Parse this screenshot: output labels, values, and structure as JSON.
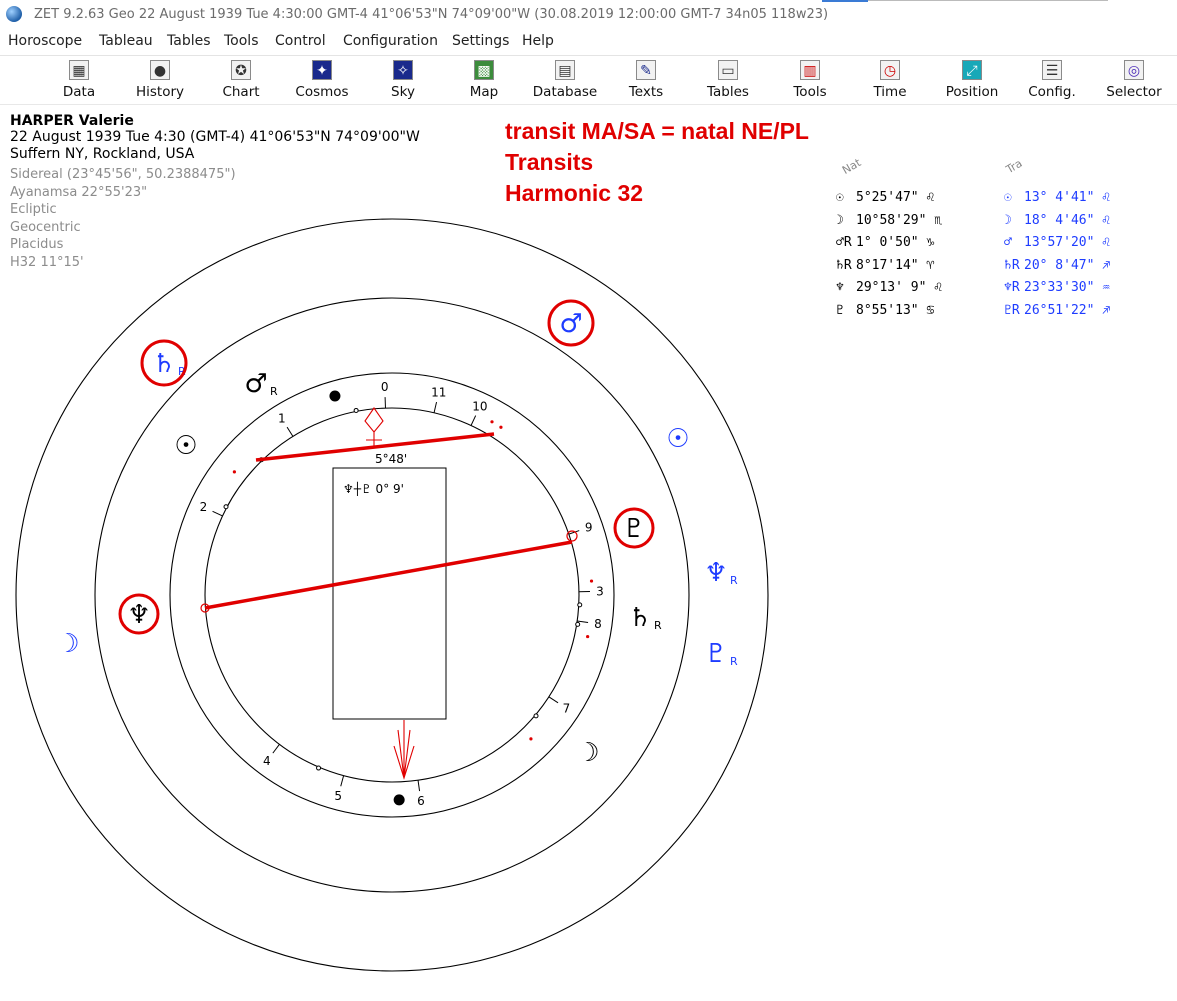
{
  "window": {
    "title": "ZET 9.2.63 Geo   22 August 1939  Tue   4:30:00 GMT-4 41°06'53\"N  74°09'00\"W  (30.08.2019  12:00:00 GMT-7 34n05 118w23)"
  },
  "menu": [
    "Horoscope",
    "Tableau",
    "Tables",
    "Tools",
    "Control",
    "Configuration",
    "Settings",
    "Help"
  ],
  "toolbar": [
    {
      "label": "Data",
      "icon": "data-icon",
      "glyph": "▦"
    },
    {
      "label": "History",
      "icon": "history-icon",
      "glyph": "●"
    },
    {
      "label": "Chart",
      "icon": "chart-icon",
      "glyph": "✪"
    },
    {
      "label": "Cosmos",
      "icon": "cosmos-icon",
      "glyph": "✦"
    },
    {
      "label": "Sky",
      "icon": "sky-icon",
      "glyph": "✧"
    },
    {
      "label": "Map",
      "icon": "map-icon",
      "glyph": "▩"
    },
    {
      "label": "Database",
      "icon": "database-icon",
      "glyph": "▤"
    },
    {
      "label": "Texts",
      "icon": "texts-icon",
      "glyph": "✎"
    },
    {
      "label": "Tables",
      "icon": "tables-icon",
      "glyph": "▭"
    },
    {
      "label": "Tools",
      "icon": "tools-icon",
      "glyph": "▥"
    },
    {
      "label": "Time",
      "icon": "time-icon",
      "glyph": "◷"
    },
    {
      "label": "Position",
      "icon": "position-icon",
      "glyph": "⤢"
    },
    {
      "label": "Config.",
      "icon": "config-icon",
      "glyph": "☰"
    },
    {
      "label": "Selector",
      "icon": "selector-icon",
      "glyph": "◎"
    }
  ],
  "person": {
    "name": "HARPER Valerie",
    "date_line": "22 August 1939  Tue   4:30 (GMT-4) 41°06'53\"N  74°09'00\"W",
    "place": "Suffern NY, Rockland, USA",
    "settings": [
      "Sidereal (23°45'56\", 50.2388475\")",
      "Ayanamsa 22°55'23\"",
      "Ecliptic",
      "Geocentric",
      "Placidus",
      "H32  11°15'"
    ]
  },
  "annotation": [
    "transit MA/SA = natal NE/PL",
    "Transits",
    "Harmonic 32"
  ],
  "table": {
    "natal_header": "Nat",
    "transit_header": "Tra",
    "natal": [
      {
        "sym": "☉",
        "pos": "5°25'47\" ♌"
      },
      {
        "sym": "☽",
        "pos": "10°58'29\" ♏"
      },
      {
        "sym": "♂R",
        "pos": "1° 0'50\" ♑"
      },
      {
        "sym": "♄R",
        "pos": "8°17'14\" ♈"
      },
      {
        "sym": "♆",
        "pos": "29°13' 9\" ♌"
      },
      {
        "sym": "♇",
        "pos": "8°55'13\" ♋"
      }
    ],
    "transit": [
      {
        "sym": "☉",
        "pos": "13° 4'41\" ♌"
      },
      {
        "sym": "☽",
        "pos": "18° 4'46\" ♌"
      },
      {
        "sym": "♂",
        "pos": "13°57'20\" ♌"
      },
      {
        "sym": "♄R",
        "pos": "20° 8'47\" ♐"
      },
      {
        "sym": "♆R",
        "pos": "23°33'30\" ♒"
      },
      {
        "sym": "♇R",
        "pos": "26°51'22\" ♐"
      }
    ]
  },
  "chart": {
    "midpoint_label": "5°48'",
    "box_label": "♆┼♇  0° 9'",
    "house_cusps": [
      "0",
      "11",
      "10",
      "9",
      "8",
      "7",
      "6",
      "5",
      "4",
      "3",
      "2",
      "1"
    ],
    "outer_planets": [
      {
        "glyph": "♄",
        "sub": "R",
        "color": "#1e3cff",
        "circled": true
      },
      {
        "glyph": "♂",
        "sub": "",
        "color": "#1e3cff",
        "circled": true
      },
      {
        "glyph": "☉",
        "sub": "",
        "color": "#1e3cff",
        "circled": false
      },
      {
        "glyph": "♆",
        "sub": "R",
        "color": "#1e3cff",
        "circled": false
      },
      {
        "glyph": "♇",
        "sub": "R",
        "color": "#1e3cff",
        "circled": false
      },
      {
        "glyph": "☽",
        "sub": "",
        "color": "#1e3cff",
        "circled": false
      }
    ],
    "inner_planets": [
      {
        "glyph": "♂",
        "sub": "R",
        "color": "#000000",
        "circled": false
      },
      {
        "glyph": "☉",
        "sub": "",
        "color": "#000000",
        "circled": false
      },
      {
        "glyph": "♇",
        "sub": "",
        "color": "#000000",
        "circled": true
      },
      {
        "glyph": "♄",
        "sub": "R",
        "color": "#000000",
        "circled": false
      },
      {
        "glyph": "♆",
        "sub": "",
        "color": "#000000",
        "circled": true
      },
      {
        "glyph": "☽",
        "sub": "",
        "color": "#000000",
        "circled": false
      }
    ],
    "highlight_color": "#e00000"
  }
}
